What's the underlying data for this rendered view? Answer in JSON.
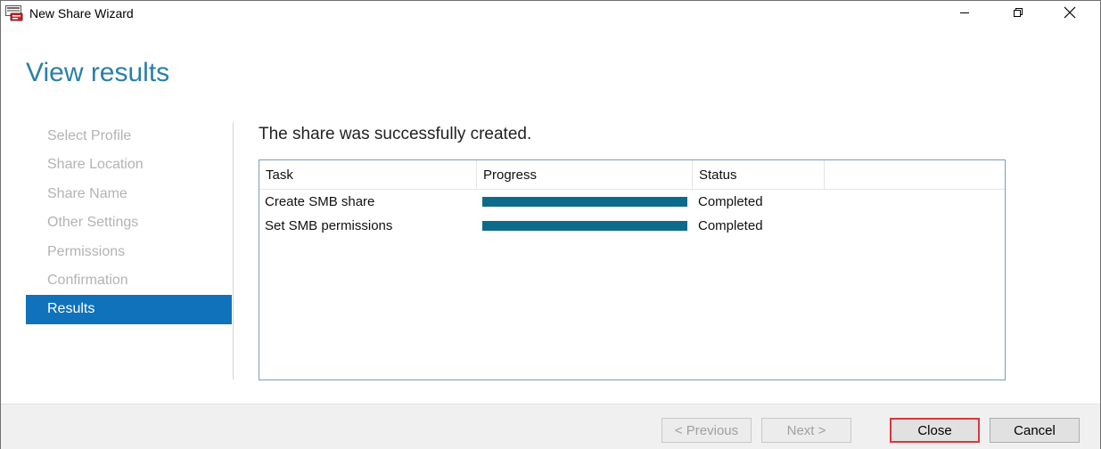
{
  "window": {
    "title": "New Share Wizard",
    "icon": "server-share-icon",
    "controls": [
      "minimize-icon",
      "restore-icon",
      "close-icon"
    ]
  },
  "page_title": "View results",
  "steps": [
    {
      "label": "Select Profile",
      "active": false
    },
    {
      "label": "Share Location",
      "active": false
    },
    {
      "label": "Share Name",
      "active": false
    },
    {
      "label": "Other Settings",
      "active": false
    },
    {
      "label": "Permissions",
      "active": false
    },
    {
      "label": "Confirmation",
      "active": false
    },
    {
      "label": "Results",
      "active": true
    }
  ],
  "result_message": "The share was successfully created.",
  "table": {
    "columns": [
      "Task",
      "Progress",
      "Status"
    ],
    "rows": [
      {
        "task": "Create SMB share",
        "progress": 1.0,
        "status": "Completed"
      },
      {
        "task": "Set SMB permissions",
        "progress": 1.0,
        "status": "Completed"
      }
    ]
  },
  "footer": {
    "previous_label": "< Previous",
    "next_label": "Next >",
    "close_label": "Close",
    "cancel_label": "Cancel"
  },
  "colors": {
    "accent": "#0f72bb",
    "progress_bar": "#0e6a8a",
    "title": "#2a7fa8",
    "highlight_border": "#d9373d"
  }
}
